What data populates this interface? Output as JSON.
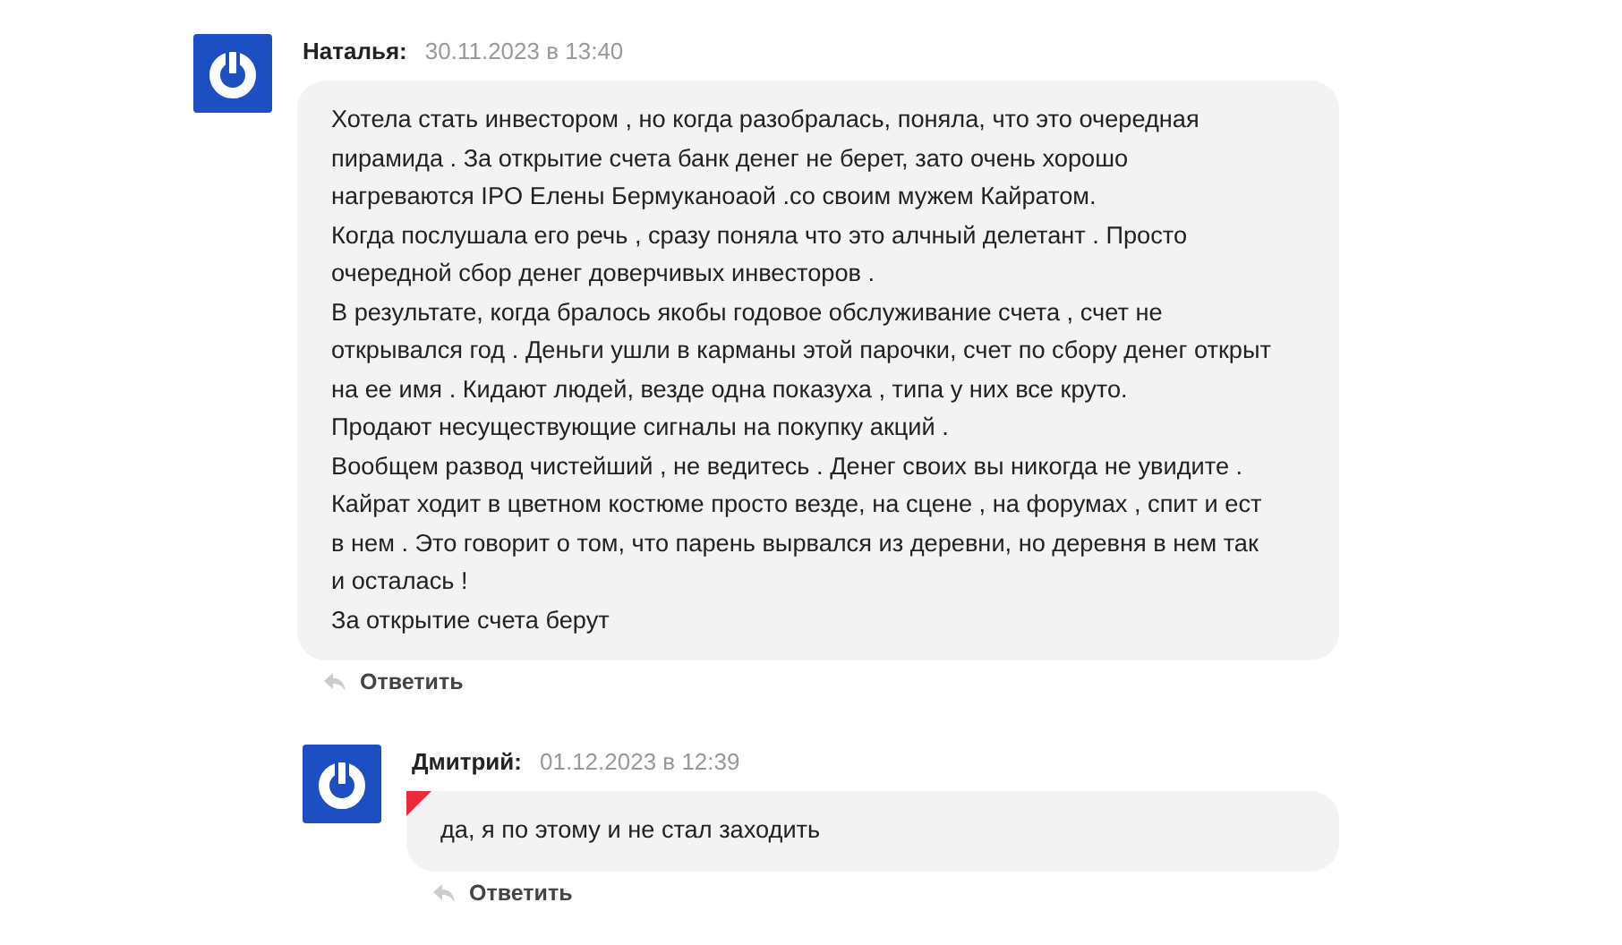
{
  "comments": [
    {
      "author": "Наталья:",
      "date": "30.11.2023 в 13:40",
      "new": false,
      "text": "Хотела стать инвестором , но когда разобралась, поняла, что это очередная пирамида . За открытие счета банк денег не берет, зато очень хорошо нагреваются IPO Елены Бермуканоаой .со своим мужем Кайратом.\nКогда послушала его речь , сразу поняла что это алчный делетант . Просто очередной сбор денег доверчивых инвесторов .\nВ результате, когда бралось якобы годовое обслуживание счета , счет не открывался год . Деньги ушли в карманы этой парочки, счет по сбору денег открыт на ее имя . Кидают людей, везде одна показуха , типа у них все круто.\nПродают несуществующие сигналы на покупку акций .\nВообщем развод чистейший , не ведитесь . Денег своих вы никогда не увидите . Кайрат ходит в цветном костюме просто везде, на сцене , на форумах , спит и ест в нем . Это говорит о том, что парень вырвался из деревни, но деревня в нем так и осталась !\nЗа открытие счета берут",
      "reply_label": "Ответить",
      "children": [
        {
          "author": "Дмитрий:",
          "date": "01.12.2023 в 12:39",
          "new": true,
          "text": "да, я по этому и не стал заходить",
          "reply_label": "Ответить"
        }
      ]
    }
  ]
}
